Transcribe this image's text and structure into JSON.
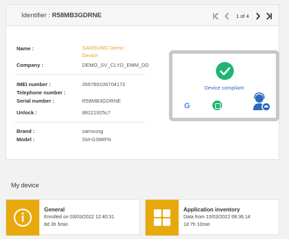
{
  "header": {
    "identifier_label": "Identifier : ",
    "identifier_value": "R58MB3GDRNE",
    "pagination": {
      "text": "1 of 4"
    }
  },
  "device_info": {
    "name_label": "Name :",
    "name_value_line1": "SAMSUNG Demo",
    "name_value_line2": "Device",
    "company_label": "Company :",
    "company_value": "DEMO_SV_CLYD_EMM_DD",
    "imei_label": "IMEI number :",
    "imei_value": "356789106704172",
    "telephone_label": "Telephone number :",
    "serial_label": "Serial number :",
    "serial_value": "R58MB3GDRNE",
    "unlock_label": "Unlock :",
    "unlock_value": "88221925c7",
    "brand_label": "Brand :",
    "brand_value": "samsung",
    "model_label": "Model :",
    "model_value": "SM-G398FN"
  },
  "device_status": {
    "text": "Device compliant",
    "google_icon_text": "G"
  },
  "my_device": {
    "title": "My device",
    "cards": [
      {
        "title": "General",
        "line1": "Enrolled on 03/03/2022 12:40:31",
        "line2": "8d 3h 5min"
      },
      {
        "title": "Application inventory",
        "line1": "Data from 10/03/2022 08:36:14",
        "line2": "1d 7h 10min"
      }
    ]
  },
  "colors": {
    "accent": "#e8a90f",
    "compliant": "#21b573",
    "link": "#2a6bbf"
  }
}
